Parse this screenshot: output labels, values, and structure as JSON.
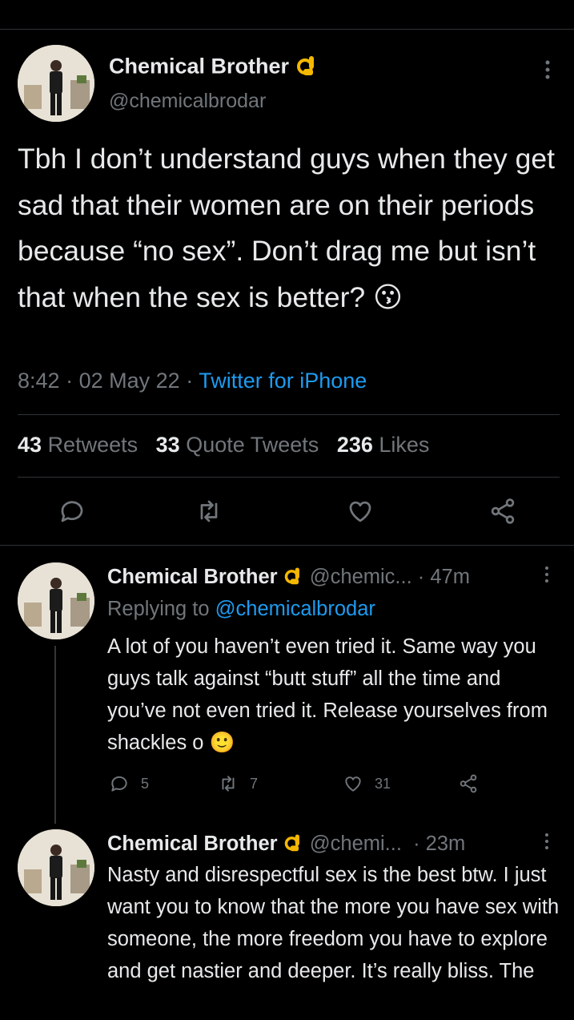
{
  "main_tweet": {
    "author_name": "Chemical Brother",
    "handle": "@chemicalbrodar",
    "text": "Tbh I don’t understand guys when they get sad that their women are on their periods because “no sex”. Don’t drag me but isn’t that when the sex is better? 😗",
    "time": "8:42",
    "date": "02 May 22",
    "separator": "·",
    "source": "Twitter for iPhone",
    "stats": {
      "retweets_count": "43",
      "retweets_label": "Retweets",
      "quotes_count": "33",
      "quotes_label": "Quote Tweets",
      "likes_count": "236",
      "likes_label": "Likes"
    },
    "actions": [
      "reply-icon",
      "retweet-icon",
      "like-icon",
      "share-icon"
    ]
  },
  "replies": [
    {
      "author_name": "Chemical Brother",
      "handle": "@chemic...",
      "time": "· 47m",
      "replying_prefix": "Replying to",
      "replying_to": "@chemicalbrodar",
      "text": "A lot of you haven’t even tried it. Same way you guys talk against “butt stuff” all the time and you’ve not even tried it. Release yourselves from shackles o 🙂",
      "reply_count": "5",
      "retweet_count": "7",
      "like_count": "31"
    },
    {
      "author_name": "Chemical Brother",
      "handle": "@chemi...",
      "time": "· 23m",
      "text": "Nasty and disrespectful sex is the best btw. I just want you to know that the more you have sex with someone, the more freedom you have to explore and get nastier and deeper. It’s really bliss. The"
    }
  ],
  "colors": {
    "background": "#000000",
    "text": "#e7e9ea",
    "muted": "#71767b",
    "link": "#1d9bf0",
    "divider": "#2f3336"
  }
}
